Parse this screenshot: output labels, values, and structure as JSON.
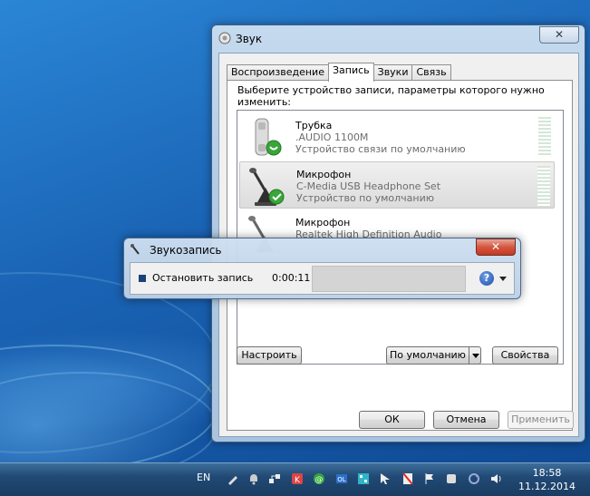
{
  "sound_window": {
    "title": "Звук",
    "close_glyph": "✕",
    "tabs": [
      {
        "label": "Воспроизведение",
        "active": false
      },
      {
        "label": "Запись",
        "active": true
      },
      {
        "label": "Звуки",
        "active": false
      },
      {
        "label": "Связь",
        "active": false
      }
    ],
    "instruction": "Выберите устройство записи, параметры которого нужно изменить:",
    "devices": [
      {
        "name": "Трубка",
        "line1": ".AUDIO 1100M",
        "line2": "Устройство связи по умолчанию",
        "icon": "handset-icon",
        "status": "default-communication",
        "selected": false
      },
      {
        "name": "Микрофон",
        "line1": "C-Media USB Headphone Set",
        "line2": "Устройство по умолчанию",
        "icon": "microphone-icon",
        "status": "default",
        "selected": true
      },
      {
        "name": "Микрофон",
        "line1": "Realtek High Definition Audio",
        "line2": "",
        "icon": "microphone-icon",
        "status": "none",
        "selected": false
      }
    ],
    "buttons": {
      "configure": "Настроить",
      "set_default": "По умолчанию",
      "properties": "Свойства",
      "ok": "ОК",
      "cancel": "Отмена",
      "apply": "Применить"
    }
  },
  "recorder": {
    "title": "Звукозапись",
    "close_glyph": "✕",
    "stop_label": "Остановить запись",
    "time": "0:00:11",
    "help_glyph": "?"
  },
  "taskbar": {
    "language": "EN",
    "time": "18:58",
    "date": "11.12.2014",
    "tray_icons": [
      "pen-icon",
      "notification-icon",
      "network-icon",
      "antivirus-icon",
      "mail-icon",
      "outlook-icon",
      "qr-icon",
      "cursor-icon",
      "flag-off-icon",
      "flag-icon",
      "device-icon",
      "sync-icon",
      "volume-icon"
    ]
  },
  "colors": {
    "accent": "#1f6fc0",
    "check_green": "#3aa53a",
    "close_red": "#c23a22"
  }
}
